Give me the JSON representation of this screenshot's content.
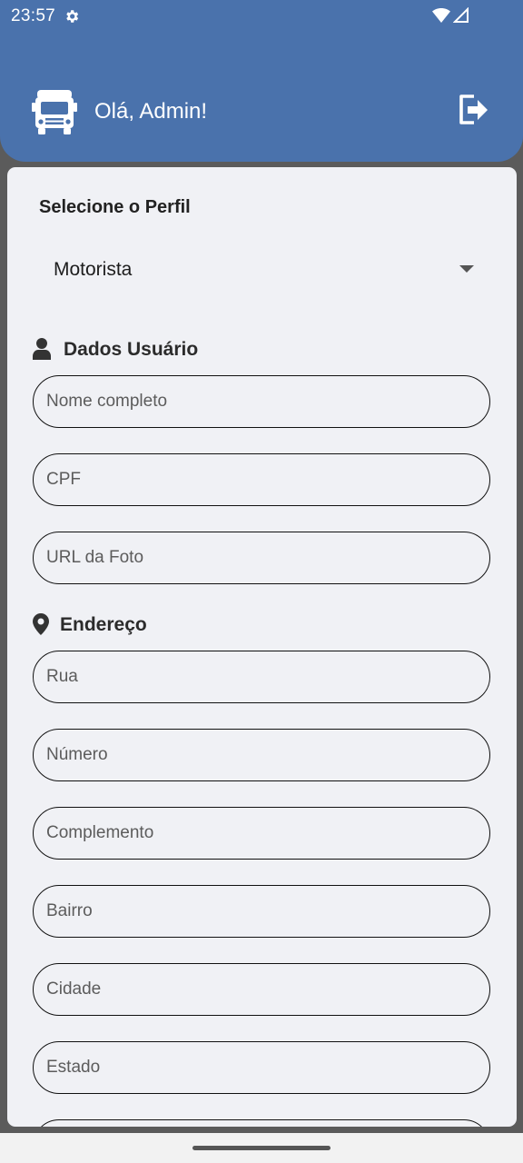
{
  "status_bar": {
    "time": "23:57"
  },
  "header": {
    "greeting": "Olá, Admin!"
  },
  "profile": {
    "label": "Selecione o Perfil",
    "selected": "Motorista"
  },
  "sections": {
    "user": {
      "title": "Dados Usuário"
    },
    "address": {
      "title": "Endereço"
    }
  },
  "fields": {
    "full_name": {
      "placeholder": "Nome completo",
      "value": ""
    },
    "cpf": {
      "placeholder": "CPF",
      "value": ""
    },
    "photo_url": {
      "placeholder": "URL da Foto",
      "value": ""
    },
    "street": {
      "placeholder": "Rua",
      "value": ""
    },
    "number": {
      "placeholder": "Número",
      "value": ""
    },
    "complement": {
      "placeholder": "Complemento",
      "value": ""
    },
    "neighborhood": {
      "placeholder": "Bairro",
      "value": ""
    },
    "city": {
      "placeholder": "Cidade",
      "value": ""
    },
    "state": {
      "placeholder": "Estado",
      "value": ""
    }
  },
  "colors": {
    "header_bg": "#4a72ac",
    "card_bg": "#f0f1f5",
    "field_border": "#111111"
  },
  "icons": [
    "settings-icon",
    "wifi-icon",
    "signal-icon",
    "truck-icon",
    "logout-icon",
    "user-icon",
    "location-pin-icon",
    "caret-down-icon"
  ]
}
